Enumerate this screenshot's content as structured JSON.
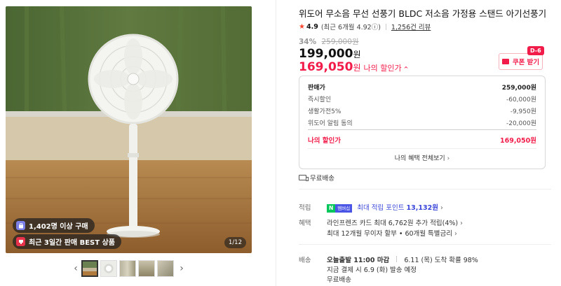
{
  "gallery": {
    "badge_buyers": "1,402명 이상 구매",
    "badge_best": "최근 3일간 판매 BEST 상품",
    "counter": "1/12",
    "prev_arrow": "‹",
    "next_arrow": "›",
    "thumbnails": [
      "fan in room",
      "fan front",
      "fan detail",
      "fan side",
      "fan close-up"
    ]
  },
  "product": {
    "title": "위도어 무소음 무선 선풍기 BLDC 저소음 가정용 스탠드 아기선풍기",
    "star": "★",
    "rating": "4.9",
    "rating_detail": "(최근 6개월 4.92ⓘ)",
    "reviews": "1,256건 리뷰",
    "discount_pct": "34%",
    "original_price": "259,000원",
    "price": "199,000",
    "price_unit": "원",
    "my_price": "169,050",
    "my_price_unit": "원",
    "my_price_label": "나의 할인가",
    "my_price_caret": "^"
  },
  "coupon": {
    "dday": "D-6",
    "label": "쿠폰 받기"
  },
  "breakdown": {
    "rows": [
      {
        "label": "판매가",
        "value": "259,000원"
      },
      {
        "label": "즉시할인",
        "value": "-60,000원"
      },
      {
        "label": "생활가전5%",
        "value": "-9,950원"
      },
      {
        "label": "위도어 알림 동의",
        "value": "-20,000원"
      }
    ],
    "total_label": "나의 할인가",
    "total_value": "169,050원",
    "benefits_link": "나의 혜택 전체보기"
  },
  "shipping_top": "무료배송",
  "points": {
    "label": "적립",
    "npay_n": "N",
    "npay_m": "멤버십",
    "text_prefix": "최대 적립 포인트",
    "amount": "13,132원"
  },
  "benefits": {
    "label": "혜택",
    "line1": "라인프렌즈 카드 최대 6,762원 추가 적립(4%)",
    "line2": "최대 12개월 무이자 할부 • 60개월 특별금리"
  },
  "delivery": {
    "label": "배송",
    "line1_bold": "오늘출발 11:00 마감",
    "line1_rest": "6.11 (목) 도착 확률 98%",
    "line2": "지금 결제 시 6.9 (화) 발송 예정",
    "line3": "무료배송"
  }
}
